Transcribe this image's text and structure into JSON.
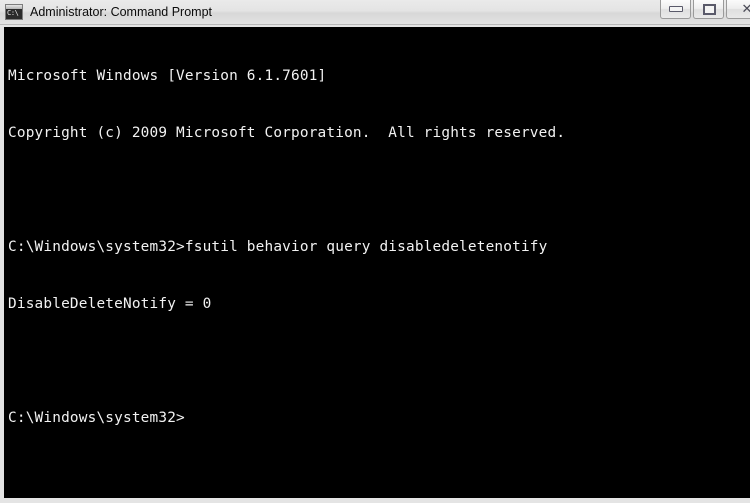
{
  "window": {
    "title": "Administrator: Command Prompt",
    "icon_name": "command-prompt-icon",
    "icon_text": "C:\\",
    "frame_color": "#e4e4e4",
    "titlebar_color": "#e2e2e2",
    "buttons": {
      "minimize_label": "",
      "maximize_label": "",
      "close_label": "✕"
    }
  },
  "console": {
    "background": "#000000",
    "foreground": "#f2f2f2",
    "lines": [
      "Microsoft Windows [Version 6.1.7601]",
      "Copyright (c) 2009 Microsoft Corporation.  All rights reserved.",
      "",
      "C:\\Windows\\system32>fsutil behavior query disabledeletenotify",
      "DisableDeleteNotify = 0",
      "",
      "C:\\Windows\\system32>"
    ],
    "line_0": "Microsoft Windows [Version 6.1.7601]",
    "line_1": "Copyright (c) 2009 Microsoft Corporation.  All rights reserved.",
    "line_2": "",
    "line_3": "C:\\Windows\\system32>fsutil behavior query disabledeletenotify",
    "line_4": "DisableDeleteNotify = 0",
    "line_5": "",
    "line_6": "C:\\Windows\\system32>"
  }
}
